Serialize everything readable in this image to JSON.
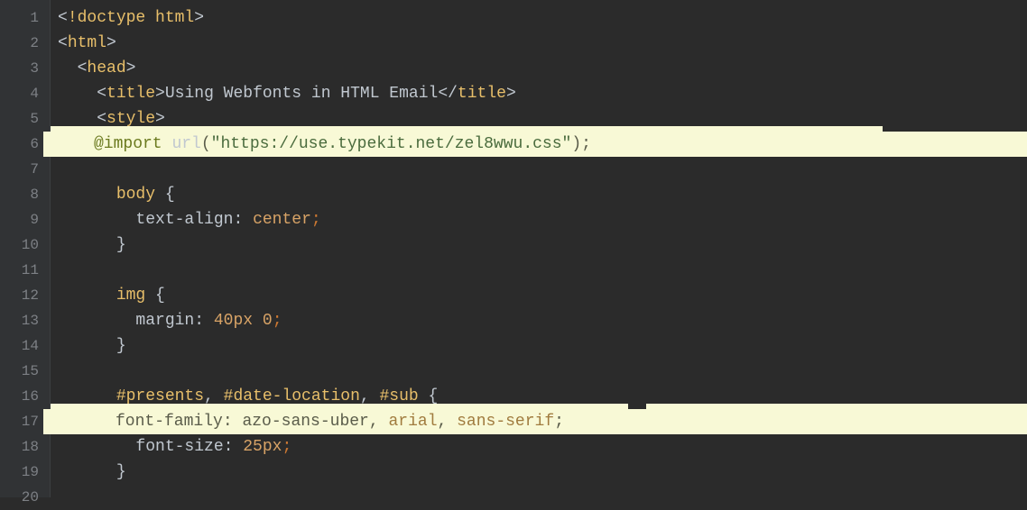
{
  "lines": {
    "l1": {
      "num": "1"
    },
    "l2": {
      "num": "2"
    },
    "l3": {
      "num": "3"
    },
    "l4": {
      "num": "4"
    },
    "l5": {
      "num": "5"
    },
    "l6": {
      "num": "6"
    },
    "l7": {
      "num": "7"
    },
    "l8": {
      "num": "8"
    },
    "l9": {
      "num": "9"
    },
    "l10": {
      "num": "10"
    },
    "l11": {
      "num": "11"
    },
    "l12": {
      "num": "12"
    },
    "l13": {
      "num": "13"
    },
    "l14": {
      "num": "14"
    },
    "l15": {
      "num": "15"
    },
    "l16": {
      "num": "16"
    },
    "l17": {
      "num": "17"
    },
    "l18": {
      "num": "18"
    },
    "l19": {
      "num": "19"
    },
    "l20": {
      "num": "20"
    }
  },
  "tok": {
    "lt": "<",
    "gt": ">",
    "ltsl": "</",
    "slgt": "/>",
    "doctype": "!doctype html",
    "html": "html",
    "head": "head",
    "title": "title",
    "style": "style",
    "title_text": "Using Webfonts in HTML Email",
    "import": "@import",
    "url_fn": "url",
    "lparen": "(",
    "rparen": ")",
    "import_url": "\"https://use.typekit.net/zel8wwu.css\"",
    "semi": ";",
    "body_sel": "body",
    "ob": "{",
    "cb": "}",
    "text_align": "text-align",
    "colon": ": ",
    "center": "center",
    "img_sel": "img",
    "margin": "margin",
    "forty": "40px",
    "zero": "0",
    "presents": "#presents",
    "comma": ", ",
    "datelocation": "#date-location",
    "sub": "#sub",
    "font_family": "font-family",
    "azo": "azo-sans-uber",
    "arial": "arial",
    "sans": "sans-serif",
    "font_size": "font-size",
    "twentyfive": "25px",
    "sp": " "
  }
}
